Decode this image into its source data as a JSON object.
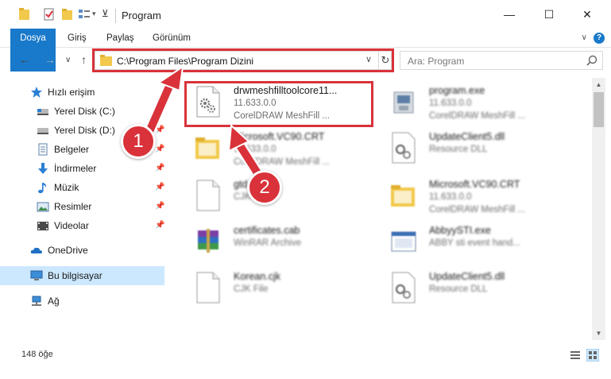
{
  "window": {
    "title": "Program",
    "minimize_glyph": "—",
    "maximize_glyph": "☐",
    "close_glyph": "✕"
  },
  "ribbon": {
    "tabs": [
      {
        "label": "Dosya",
        "active": true
      },
      {
        "label": "Giriş"
      },
      {
        "label": "Paylaş"
      },
      {
        "label": "Görünüm"
      }
    ],
    "help_glyph": "?",
    "collapse_glyph": "∨"
  },
  "navigation": {
    "back_glyph": "←",
    "forward_glyph": "→",
    "recent_glyph": "∨",
    "up_glyph": "↑",
    "address": "C:\\Program Files\\Program Dizini",
    "dropdown_glyph": "∨",
    "refresh_glyph": "↻",
    "search_placeholder": "Ara: Program"
  },
  "sidebar": {
    "items": [
      {
        "label": "Hızlı erişim",
        "icon": "star-icon"
      },
      {
        "label": "Yerel Disk (C:)",
        "icon": "drive-icon",
        "pinned": true
      },
      {
        "label": "Yerel Disk (D:)",
        "icon": "drive-icon",
        "pinned": true
      },
      {
        "label": "Belgeler",
        "icon": "documents-icon",
        "pinned": true
      },
      {
        "label": "İndirmeler",
        "icon": "download-icon",
        "pinned": true
      },
      {
        "label": "Müzik",
        "icon": "music-icon",
        "pinned": true
      },
      {
        "label": "Resimler",
        "icon": "pictures-icon",
        "pinned": true
      },
      {
        "label": "Videolar",
        "icon": "videos-icon",
        "pinned": true
      },
      {
        "label": "OneDrive",
        "icon": "cloud-icon"
      },
      {
        "label": "Bu bilgisayar",
        "icon": "computer-icon",
        "selected": true
      },
      {
        "label": "Ağ",
        "icon": "network-icon"
      }
    ],
    "pin_glyph": "📌"
  },
  "files": [
    {
      "name": "drwmeshfilltoolcore11...",
      "line2": "11.633.0.0",
      "line3": "CorelDRAW MeshFill ...",
      "icon": "dll-gear-icon",
      "highlighted": true
    },
    {
      "name": "program.exe",
      "line2": "11.633.0.0",
      "line3": "CorelDRAW MeshFill ...",
      "icon": "exe-icon"
    },
    {
      "name": "Microsoft.VC90.CRT",
      "line2": "11.633.0.0",
      "line3": "CorelDRAW MeshFill ...",
      "icon": "folder-icon"
    },
    {
      "name": "UpdateClient5.dll",
      "line2": "Resource DLL",
      "line3": "",
      "icon": "dll-gear-icon"
    },
    {
      "name": "gtd.cjk",
      "line2": "CJK File",
      "line3": "",
      "icon": "blank-file-icon"
    },
    {
      "name": "Microsoft.VC90.CRT",
      "line2": "11.633.0.0",
      "line3": "CorelDRAW MeshFill ...",
      "icon": "folder-icon"
    },
    {
      "name": "certificates.cab",
      "line2": "WinRAR Archive",
      "line3": "",
      "icon": "winrar-icon"
    },
    {
      "name": "AbbyySTI.exe",
      "line2": "ABBY sti event hand...",
      "line3": "",
      "icon": "exe-window-icon"
    },
    {
      "name": "Korean.cjk",
      "line2": "CJK File",
      "line3": "",
      "icon": "blank-file-icon"
    },
    {
      "name": "UpdateClient5.dll",
      "line2": "Resource DLL",
      "line3": "",
      "icon": "dll-gear-icon"
    }
  ],
  "status": {
    "item_count": "148 öğe"
  },
  "callouts": {
    "step1": "1",
    "step2": "2"
  },
  "colors": {
    "accent": "#1979ca",
    "highlight": "#d9323a",
    "selection": "#cce8ff"
  }
}
